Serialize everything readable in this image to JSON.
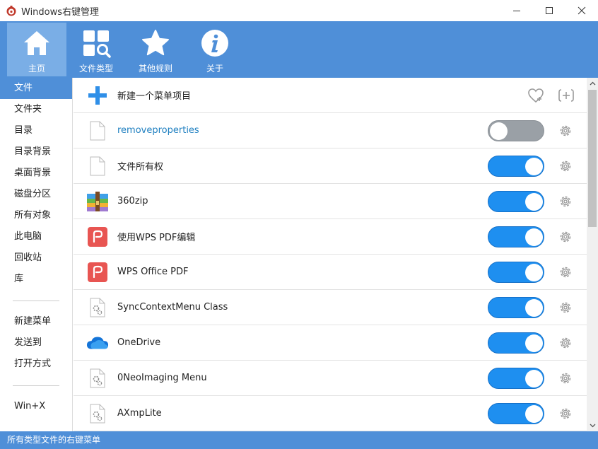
{
  "window": {
    "title": "Windows右键管理"
  },
  "toolbar": {
    "items": [
      {
        "label": "主页",
        "icon": "home-icon",
        "active": true
      },
      {
        "label": "文件类型",
        "icon": "file-types-icon",
        "active": false
      },
      {
        "label": "其他规则",
        "icon": "star-icon",
        "active": false
      },
      {
        "label": "关于",
        "icon": "info-icon",
        "active": false
      }
    ]
  },
  "sidebar": {
    "group1": [
      "文件",
      "文件夹",
      "目录",
      "目录背景",
      "桌面背景",
      "磁盘分区",
      "所有对象",
      "此电脑",
      "回收站",
      "库"
    ],
    "group2": [
      "新建菜单",
      "发送到",
      "打开方式"
    ],
    "group3": [
      "Win+X"
    ],
    "active": "文件"
  },
  "main": {
    "new_item_label": "新建一个菜单项目",
    "rows": [
      {
        "label": "removeproperties",
        "icon": "blank-file-icon",
        "enabled": false
      },
      {
        "label": "文件所有权",
        "icon": "blank-file-icon",
        "enabled": true
      },
      {
        "label": "360zip",
        "icon": "360zip-icon",
        "enabled": true
      },
      {
        "label": "使用WPS PDF编辑",
        "icon": "wps-pdf-icon",
        "enabled": true
      },
      {
        "label": "WPS Office PDF",
        "icon": "wps-pdf-icon",
        "enabled": true
      },
      {
        "label": "SyncContextMenu Class",
        "icon": "gear-file-icon",
        "enabled": true
      },
      {
        "label": "OneDrive",
        "icon": "onedrive-icon",
        "enabled": true
      },
      {
        "label": "0NeoImaging Menu",
        "icon": "gear-file-icon",
        "enabled": true
      },
      {
        "label": "AXmpLite",
        "icon": "gear-file-icon",
        "enabled": true
      }
    ]
  },
  "statusbar": {
    "text": "所有类型文件的右键菜单"
  },
  "colors": {
    "accent": "#4f8fd8",
    "toggle_on": "#1e8ff0",
    "toggle_off": "#9aa0a6"
  }
}
